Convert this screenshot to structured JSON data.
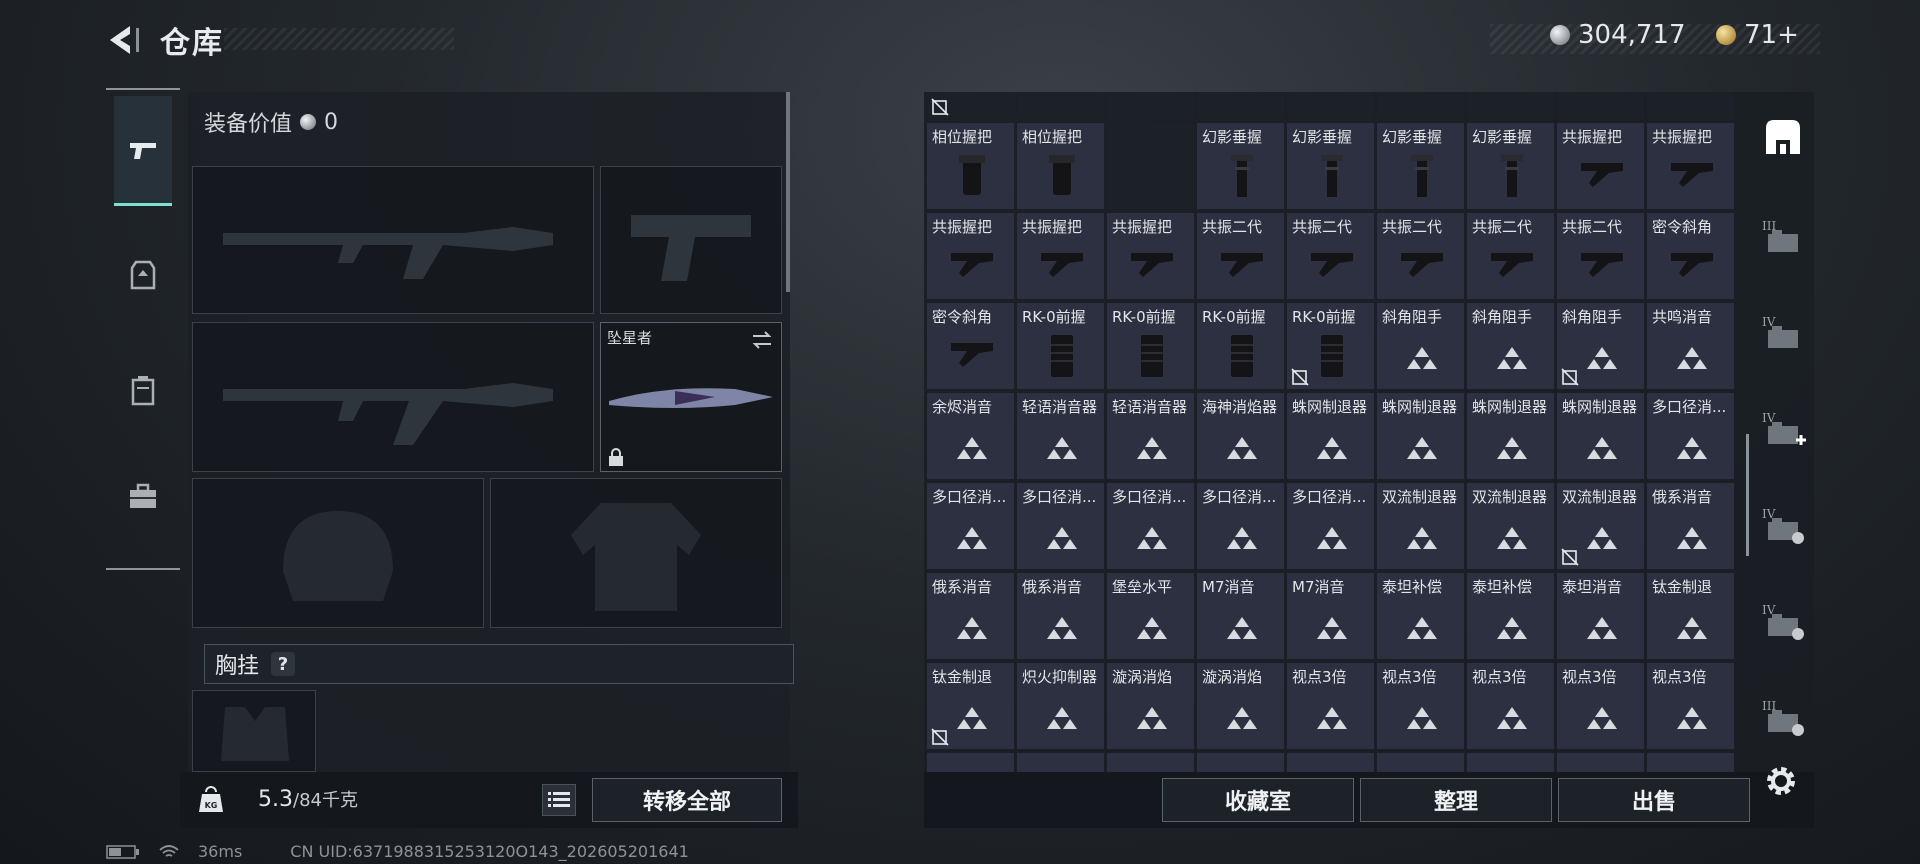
{
  "header": {
    "title": "仓库"
  },
  "currency": {
    "silver": "304,717",
    "gold": "71+"
  },
  "loadout": {
    "equip_value_label": "装备价值",
    "equip_value": "0",
    "melee_name": "坠星者",
    "chest_rig_label": "胸挂",
    "help": "?",
    "weight": "5.3",
    "weight_cap": "/84千克",
    "kg_label": "KG",
    "transfer_all": "转移全部"
  },
  "inventory": {
    "rows": [
      [
        {
          "name": "相位握把",
          "icon": "grip-icon",
          "no_trade": false
        },
        {
          "name": "相位握把",
          "icon": "grip-icon",
          "no_trade": false
        },
        {
          "name": "",
          "icon": "empty",
          "no_trade": false
        },
        {
          "name": "幻影垂握",
          "icon": "vertical-grip-icon",
          "no_trade": false
        },
        {
          "name": "幻影垂握",
          "icon": "vertical-grip-icon",
          "no_trade": false
        },
        {
          "name": "幻影垂握",
          "icon": "vertical-grip-icon",
          "no_trade": false
        },
        {
          "name": "幻影垂握",
          "icon": "vertical-grip-icon",
          "no_trade": false
        },
        {
          "name": "共振握把",
          "icon": "angled-grip-icon",
          "no_trade": false
        },
        {
          "name": "共振握把",
          "icon": "angled-grip-icon",
          "no_trade": false
        }
      ],
      [
        {
          "name": "共振握把",
          "icon": "angled-grip-icon",
          "no_trade": false
        },
        {
          "name": "共振握把",
          "icon": "angled-grip-icon",
          "no_trade": false
        },
        {
          "name": "共振握把",
          "icon": "angled-grip-icon",
          "no_trade": false
        },
        {
          "name": "共振二代",
          "icon": "angled-grip-icon",
          "no_trade": false
        },
        {
          "name": "共振二代",
          "icon": "angled-grip-icon",
          "no_trade": false
        },
        {
          "name": "共振二代",
          "icon": "angled-grip-icon",
          "no_trade": false
        },
        {
          "name": "共振二代",
          "icon": "angled-grip-icon",
          "no_trade": false
        },
        {
          "name": "共振二代",
          "icon": "angled-grip-icon",
          "no_trade": false
        },
        {
          "name": "密令斜角",
          "icon": "angled-grip-icon",
          "no_trade": false
        }
      ],
      [
        {
          "name": "密令斜角",
          "icon": "angled-grip-icon",
          "no_trade": false
        },
        {
          "name": "RK-0前握",
          "icon": "foregrip-icon",
          "no_trade": false
        },
        {
          "name": "RK-0前握",
          "icon": "foregrip-icon",
          "no_trade": false
        },
        {
          "name": "RK-0前握",
          "icon": "foregrip-icon",
          "no_trade": false
        },
        {
          "name": "RK-0前握",
          "icon": "foregrip-icon",
          "no_trade": true
        },
        {
          "name": "斜角阻手",
          "icon": "placeholder-triangle-icon",
          "no_trade": false
        },
        {
          "name": "斜角阻手",
          "icon": "placeholder-triangle-icon",
          "no_trade": false
        },
        {
          "name": "斜角阻手",
          "icon": "placeholder-triangle-icon",
          "no_trade": true
        },
        {
          "name": "共鸣消音",
          "icon": "placeholder-triangle-icon",
          "no_trade": false
        }
      ],
      [
        {
          "name": "余烬消音",
          "icon": "placeholder-triangle-icon",
          "no_trade": false
        },
        {
          "name": "轻语消音器",
          "icon": "placeholder-triangle-icon",
          "no_trade": false
        },
        {
          "name": "轻语消音器",
          "icon": "placeholder-triangle-icon",
          "no_trade": false
        },
        {
          "name": "海神消焰器",
          "icon": "placeholder-triangle-icon",
          "no_trade": false
        },
        {
          "name": "蛛网制退器",
          "icon": "placeholder-triangle-icon",
          "no_trade": false
        },
        {
          "name": "蛛网制退器",
          "icon": "placeholder-triangle-icon",
          "no_trade": false
        },
        {
          "name": "蛛网制退器",
          "icon": "placeholder-triangle-icon",
          "no_trade": false
        },
        {
          "name": "蛛网制退器",
          "icon": "placeholder-triangle-icon",
          "no_trade": false
        },
        {
          "name": "多口径消...",
          "icon": "placeholder-triangle-icon",
          "no_trade": false
        }
      ],
      [
        {
          "name": "多口径消...",
          "icon": "placeholder-triangle-icon",
          "no_trade": false
        },
        {
          "name": "多口径消...",
          "icon": "placeholder-triangle-icon",
          "no_trade": false
        },
        {
          "name": "多口径消...",
          "icon": "placeholder-triangle-icon",
          "no_trade": false
        },
        {
          "name": "多口径消...",
          "icon": "placeholder-triangle-icon",
          "no_trade": false
        },
        {
          "name": "多口径消...",
          "icon": "placeholder-triangle-icon",
          "no_trade": false
        },
        {
          "name": "双流制退器",
          "icon": "placeholder-triangle-icon",
          "no_trade": false
        },
        {
          "name": "双流制退器",
          "icon": "placeholder-triangle-icon",
          "no_trade": false
        },
        {
          "name": "双流制退器",
          "icon": "placeholder-triangle-icon",
          "no_trade": true
        },
        {
          "name": "俄系消音",
          "icon": "placeholder-triangle-icon",
          "no_trade": false
        }
      ],
      [
        {
          "name": "俄系消音",
          "icon": "placeholder-triangle-icon",
          "no_trade": false
        },
        {
          "name": "俄系消音",
          "icon": "placeholder-triangle-icon",
          "no_trade": false
        },
        {
          "name": "堡垒水平",
          "icon": "placeholder-triangle-icon",
          "no_trade": false
        },
        {
          "name": "M7消音",
          "icon": "placeholder-triangle-icon",
          "no_trade": false
        },
        {
          "name": "M7消音",
          "icon": "placeholder-triangle-icon",
          "no_trade": false
        },
        {
          "name": "泰坦补偿",
          "icon": "placeholder-triangle-icon",
          "no_trade": false
        },
        {
          "name": "泰坦补偿",
          "icon": "placeholder-triangle-icon",
          "no_trade": false
        },
        {
          "name": "泰坦消音",
          "icon": "placeholder-triangle-icon",
          "no_trade": false
        },
        {
          "name": "钛金制退",
          "icon": "placeholder-triangle-icon",
          "no_trade": false
        }
      ],
      [
        {
          "name": "钛金制退",
          "icon": "placeholder-triangle-icon",
          "no_trade": true
        },
        {
          "name": "炽火抑制器",
          "icon": "placeholder-triangle-icon",
          "no_trade": false
        },
        {
          "name": "漩涡消焰",
          "icon": "placeholder-triangle-icon",
          "no_trade": false
        },
        {
          "name": "漩涡消焰",
          "icon": "placeholder-triangle-icon",
          "no_trade": false
        },
        {
          "name": "视点3倍",
          "icon": "placeholder-triangle-icon",
          "no_trade": false
        },
        {
          "name": "视点3倍",
          "icon": "placeholder-triangle-icon",
          "no_trade": false
        },
        {
          "name": "视点3倍",
          "icon": "placeholder-triangle-icon",
          "no_trade": false
        },
        {
          "name": "视点3倍",
          "icon": "placeholder-triangle-icon",
          "no_trade": false
        },
        {
          "name": "视点3倍",
          "icon": "placeholder-triangle-icon",
          "no_trade": false
        }
      ]
    ],
    "buttons": {
      "collection": "收藏室",
      "organize": "整理",
      "sell": "出售"
    }
  },
  "right_rail": [
    {
      "icon": "main-storage-icon"
    },
    {
      "icon": "storage-tier-3-icon"
    },
    {
      "icon": "storage-tier-4-icon"
    },
    {
      "icon": "storage-tier-4-add-icon"
    },
    {
      "icon": "storage-tier-4-lock-icon"
    },
    {
      "icon": "storage-tier-4-lock-icon"
    },
    {
      "icon": "storage-tier-3-lock-icon"
    }
  ],
  "status": {
    "ping": "36ms",
    "uid": "CN UID:6371988315253120O143_202605201641"
  },
  "colors": {
    "accent": "#7ee0d0",
    "cell_bg": "#2d3040",
    "panel_bg": "#1c2026"
  }
}
